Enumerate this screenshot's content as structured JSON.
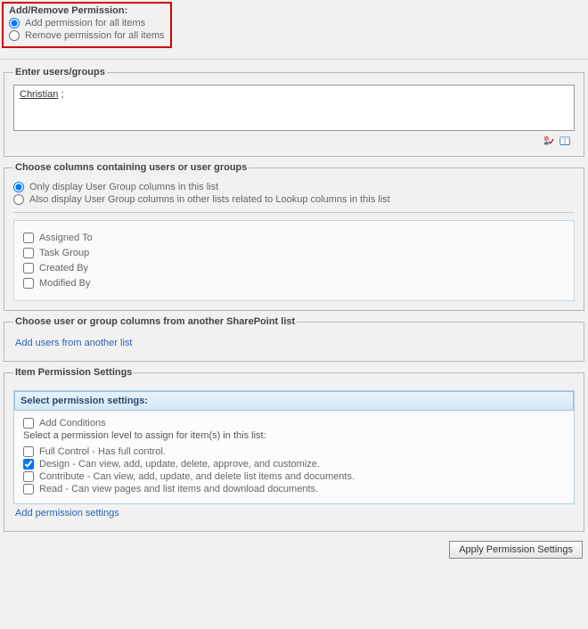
{
  "addRemove": {
    "title": "Add/Remove Permission:",
    "options": {
      "add": "Add permission for all items",
      "remove": "Remove permission for all items"
    },
    "selected": "add"
  },
  "enterUsers": {
    "legend": "Enter users/groups",
    "value": "Christian",
    "suffix": " ;",
    "checkIcon": "check-names-icon",
    "browseIcon": "browse-icon"
  },
  "chooseColumns": {
    "legend": "Choose columns containing users or user groups",
    "scopeOptions": {
      "thisList": "Only display User Group columns in this list",
      "lookup": "Also display User Group columns in other lists related to Lookup columns in this list"
    },
    "scopeSelected": "thisList",
    "columns": [
      {
        "label": "Assigned To",
        "checked": false
      },
      {
        "label": "Task Group",
        "checked": false
      },
      {
        "label": "Created By",
        "checked": false
      },
      {
        "label": "Modified By",
        "checked": false
      }
    ]
  },
  "anotherList": {
    "legend": "Choose user or group columns from another SharePoint list",
    "link": "Add users from another list"
  },
  "itemPerm": {
    "legend": "Item Permission Settings",
    "selectHeader": "Select permission settings:",
    "addConditions": "Add Conditions",
    "prompt": "Select a permission level to assign for item(s) in this list:",
    "levels": [
      {
        "label": "Full Control - Has full control.",
        "checked": false
      },
      {
        "label": "Design - Can view, add, update, delete, approve, and customize.",
        "checked": true
      },
      {
        "label": "Contribute - Can view, add, update, and delete list items and documents.",
        "checked": false
      },
      {
        "label": "Read - Can view pages and list items and download documents.",
        "checked": false
      }
    ],
    "addLink": "Add permission settings"
  },
  "applyButton": "Apply Permission Settings"
}
